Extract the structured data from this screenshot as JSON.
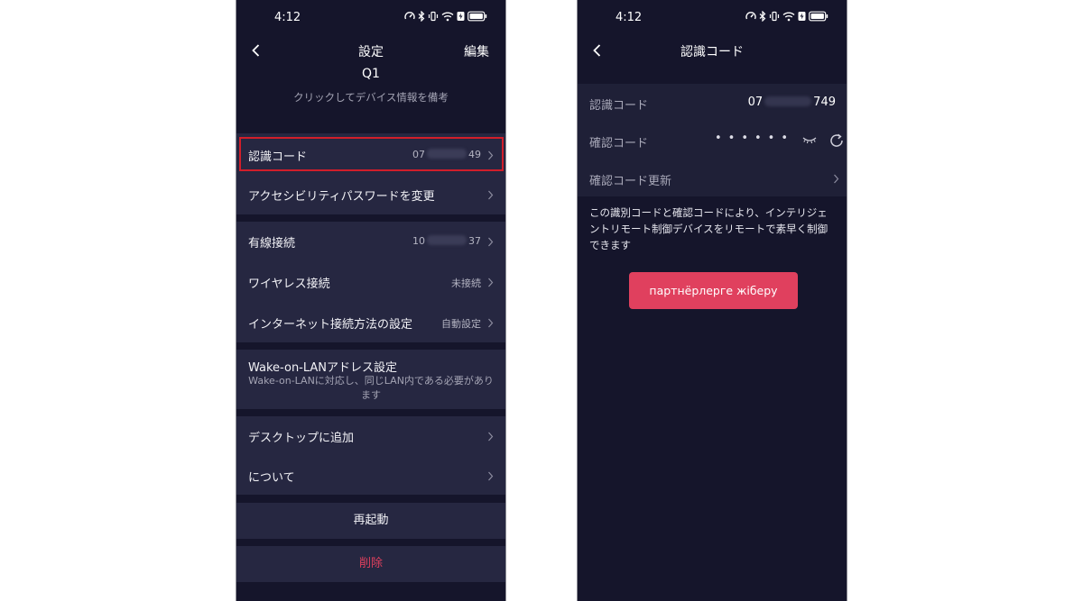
{
  "status_bar": {
    "time": "4:12"
  },
  "settings_screen": {
    "title": "設定",
    "edit_label": "編集",
    "device_name": "Q1",
    "device_note": "クリックしてデバイス情報を備考",
    "identification_code": {
      "label": "認識コード",
      "value_start": "07",
      "value_end": "49"
    },
    "accessibility_password": {
      "label": "アクセシビリティパスワードを変更"
    },
    "wired_connection": {
      "label": "有線接続",
      "value_start": "10",
      "value_end": "37"
    },
    "wireless_connection": {
      "label": "ワイヤレス接続",
      "value": "未接続"
    },
    "internet_method": {
      "label": "インターネット接続方法の設定",
      "value": "自動設定"
    },
    "wake_on_lan": {
      "label": "Wake-on-LANアドレス設定",
      "description": "Wake-on-LANに対応し、同じLAN内である必要があります"
    },
    "add_to_desktop": {
      "label": "デスクトップに追加"
    },
    "about": {
      "label": "について"
    },
    "restart_label": "再起動",
    "delete_label": "削除"
  },
  "code_screen": {
    "title": "認識コード",
    "identification_code": {
      "label": "認識コード",
      "value_start": "07",
      "value_end": "749"
    },
    "verification_code": {
      "label": "確認コード",
      "masked": "••••••"
    },
    "update_verification": {
      "label": "確認コード更新"
    },
    "description": "この識別コードと確認コードにより、インテリジェントリモート制御デバイスをリモートで素早く制御できます",
    "send_button_label": "партнёрлерге жіберу"
  },
  "colors": {
    "background": "#15152b",
    "row_background": "#262741",
    "highlight_border": "#d11e2a",
    "delete_text": "#e0405e",
    "send_button": "#e0405e"
  },
  "icons": [
    "back-arrow-icon",
    "chevron-right-icon",
    "eye-closed-icon",
    "refresh-icon",
    "speedometer-icon",
    "bluetooth-icon",
    "vibrate-icon",
    "wifi-icon",
    "battery-saver-icon",
    "battery-icon"
  ]
}
